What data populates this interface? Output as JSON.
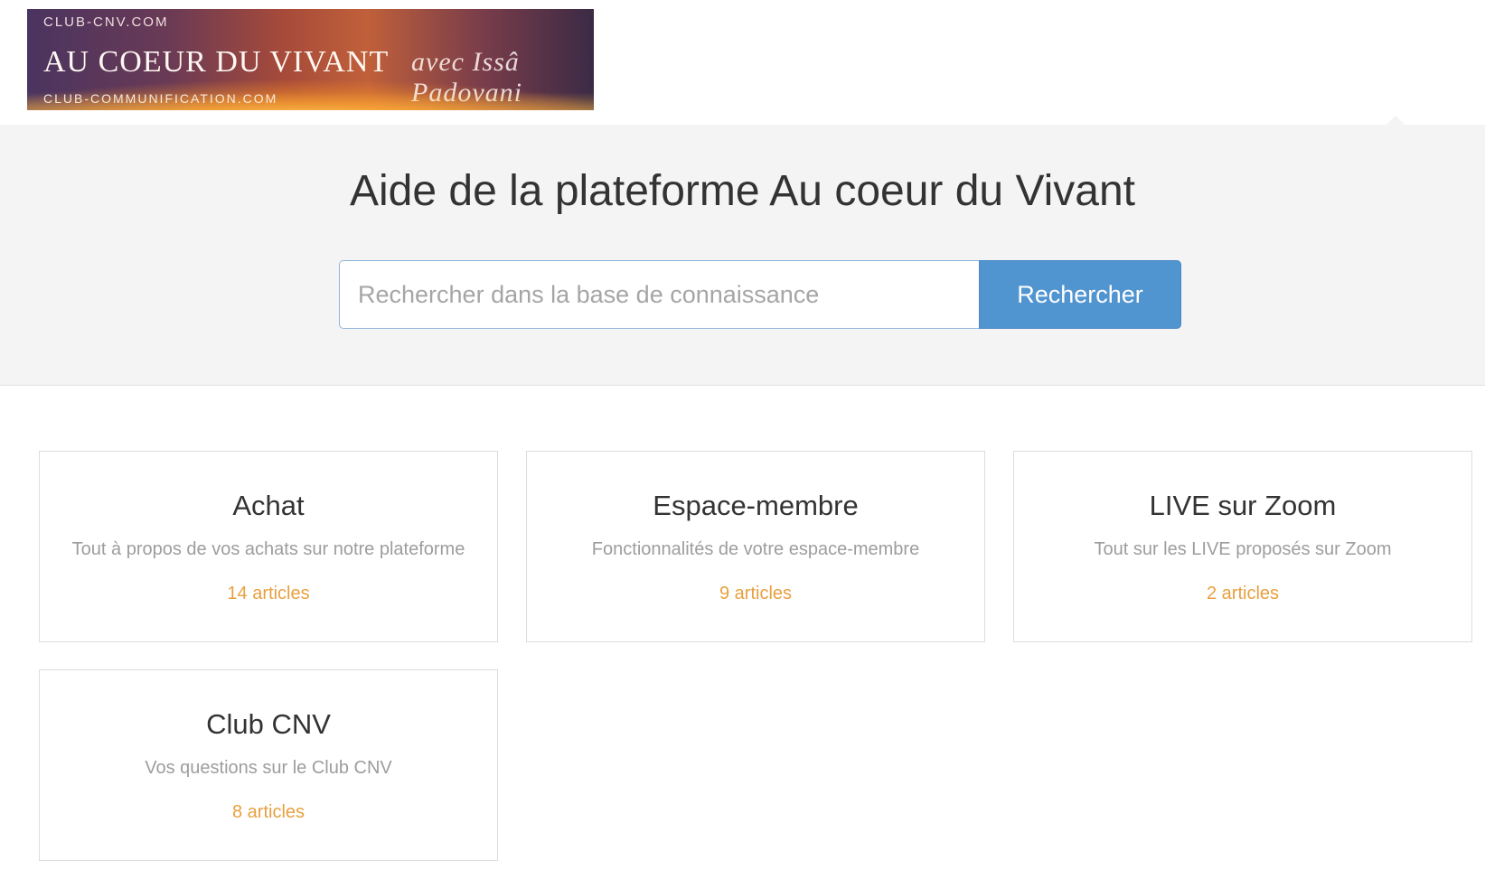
{
  "header": {
    "logo": {
      "top_text": "CLUB-CNV.COM",
      "main_text": "AU COEUR DU VIVANT",
      "signature": "avec Issâ Padovani",
      "bottom_text": "CLUB-COMMUNIFICATION.COM"
    }
  },
  "hero": {
    "title": "Aide de la plateforme Au coeur du Vivant",
    "search": {
      "placeholder": "Rechercher dans la base de connaissance",
      "value": "",
      "button_label": "Rechercher"
    }
  },
  "categories": [
    {
      "title": "Achat",
      "description": "Tout à propos de vos achats sur notre plateforme",
      "count": "14 articles"
    },
    {
      "title": "Espace-membre",
      "description": "Fonctionnalités de votre espace-membre",
      "count": "9 articles"
    },
    {
      "title": "LIVE sur Zoom",
      "description": "Tout sur les LIVE proposés sur Zoom",
      "count": "2 articles"
    },
    {
      "title": "Club CNV",
      "description": "Vos questions sur le Club CNV",
      "count": "8 articles"
    }
  ],
  "colors": {
    "hero_background": "#f4f4f4",
    "button_background": "#5094d0",
    "article_count": "#e8a040",
    "description_text": "#9d9d9d"
  }
}
